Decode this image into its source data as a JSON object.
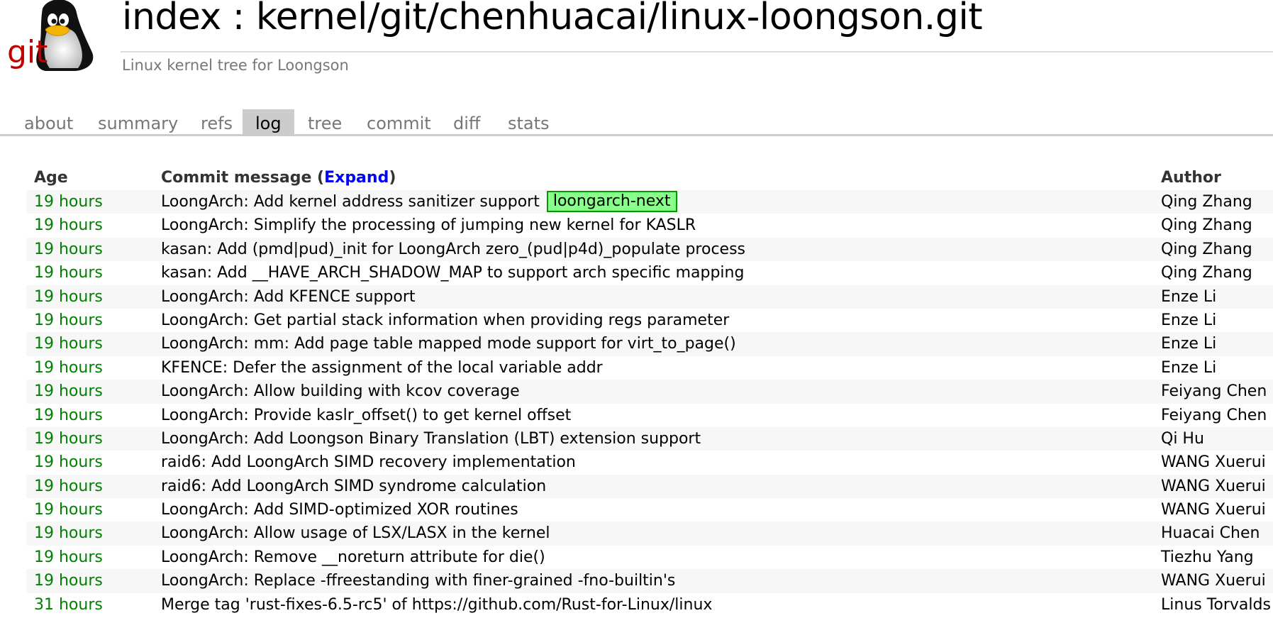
{
  "header": {
    "logo_alt": "cgit logo",
    "logo_text": "git",
    "title": "index : kernel/git/chenhuacai/linux-loongson.git",
    "subtitle": "Linux kernel tree for Loongson"
  },
  "tabs": [
    {
      "label": "about",
      "active": false
    },
    {
      "label": "summary",
      "active": false
    },
    {
      "label": "refs",
      "active": false
    },
    {
      "label": "log",
      "active": true
    },
    {
      "label": "tree",
      "active": false
    },
    {
      "label": "commit",
      "active": false
    },
    {
      "label": "diff",
      "active": false
    },
    {
      "label": "stats",
      "active": false
    }
  ],
  "log_table": {
    "headers": {
      "age": "Age",
      "message_prefix": "Commit message (",
      "expand": "Expand",
      "message_suffix": ")",
      "author": "Author"
    },
    "rows": [
      {
        "age": "19 hours",
        "message": "LoongArch: Add kernel address sanitizer support",
        "branch": "loongarch-next",
        "author": "Qing Zhang"
      },
      {
        "age": "19 hours",
        "message": "LoongArch: Simplify the processing of jumping new kernel for KASLR",
        "author": "Qing Zhang"
      },
      {
        "age": "19 hours",
        "message": "kasan: Add (pmd|pud)_init for LoongArch zero_(pud|p4d)_populate process",
        "author": "Qing Zhang"
      },
      {
        "age": "19 hours",
        "message": "kasan: Add __HAVE_ARCH_SHADOW_MAP to support arch specific mapping",
        "author": "Qing Zhang"
      },
      {
        "age": "19 hours",
        "message": "LoongArch: Add KFENCE support",
        "author": "Enze Li"
      },
      {
        "age": "19 hours",
        "message": "LoongArch: Get partial stack information when providing regs parameter",
        "author": "Enze Li"
      },
      {
        "age": "19 hours",
        "message": "LoongArch: mm: Add page table mapped mode support for virt_to_page()",
        "author": "Enze Li"
      },
      {
        "age": "19 hours",
        "message": "KFENCE: Defer the assignment of the local variable addr",
        "author": "Enze Li"
      },
      {
        "age": "19 hours",
        "message": "LoongArch: Allow building with kcov coverage",
        "author": "Feiyang Chen"
      },
      {
        "age": "19 hours",
        "message": "LoongArch: Provide kaslr_offset() to get kernel offset",
        "author": "Feiyang Chen"
      },
      {
        "age": "19 hours",
        "message": "LoongArch: Add Loongson Binary Translation (LBT) extension support",
        "author": "Qi Hu"
      },
      {
        "age": "19 hours",
        "message": "raid6: Add LoongArch SIMD recovery implementation",
        "author": "WANG Xuerui"
      },
      {
        "age": "19 hours",
        "message": "raid6: Add LoongArch SIMD syndrome calculation",
        "author": "WANG Xuerui"
      },
      {
        "age": "19 hours",
        "message": "LoongArch: Add SIMD-optimized XOR routines",
        "author": "WANG Xuerui"
      },
      {
        "age": "19 hours",
        "message": "LoongArch: Allow usage of LSX/LASX in the kernel",
        "author": "Huacai Chen"
      },
      {
        "age": "19 hours",
        "message": "LoongArch: Remove __noreturn attribute for die()",
        "author": "Tiezhu Yang"
      },
      {
        "age": "19 hours",
        "message": "LoongArch: Replace -ffreestanding with finer-grained -fno-builtin's",
        "author": "WANG Xuerui"
      },
      {
        "age": "31 hours",
        "message": "Merge tag 'rust-fixes-6.5-rc5' of https://github.com/Rust-for-Linux/linux",
        "author": "Linus Torvalds"
      }
    ]
  },
  "colors": {
    "age_green": "#008000",
    "link_blue": "#0000ff",
    "branch_badge_bg": "#88ff88",
    "branch_badge_border": "#009900",
    "row_stripe": "#f7f7f7",
    "active_tab_bg": "#cccccc"
  }
}
